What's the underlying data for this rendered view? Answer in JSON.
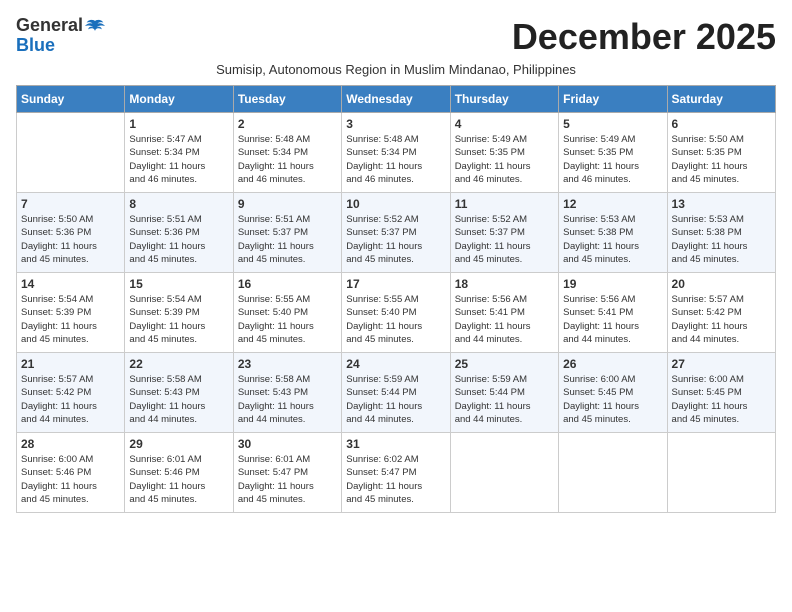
{
  "logo": {
    "general": "General",
    "blue": "Blue"
  },
  "title": "December 2025",
  "subtitle": "Sumisip, Autonomous Region in Muslim Mindanao, Philippines",
  "days_header": [
    "Sunday",
    "Monday",
    "Tuesday",
    "Wednesday",
    "Thursday",
    "Friday",
    "Saturday"
  ],
  "weeks": [
    [
      {
        "day": "",
        "info": ""
      },
      {
        "day": "1",
        "info": "Sunrise: 5:47 AM\nSunset: 5:34 PM\nDaylight: 11 hours\nand 46 minutes."
      },
      {
        "day": "2",
        "info": "Sunrise: 5:48 AM\nSunset: 5:34 PM\nDaylight: 11 hours\nand 46 minutes."
      },
      {
        "day": "3",
        "info": "Sunrise: 5:48 AM\nSunset: 5:34 PM\nDaylight: 11 hours\nand 46 minutes."
      },
      {
        "day": "4",
        "info": "Sunrise: 5:49 AM\nSunset: 5:35 PM\nDaylight: 11 hours\nand 46 minutes."
      },
      {
        "day": "5",
        "info": "Sunrise: 5:49 AM\nSunset: 5:35 PM\nDaylight: 11 hours\nand 46 minutes."
      },
      {
        "day": "6",
        "info": "Sunrise: 5:50 AM\nSunset: 5:35 PM\nDaylight: 11 hours\nand 45 minutes."
      }
    ],
    [
      {
        "day": "7",
        "info": "Sunrise: 5:50 AM\nSunset: 5:36 PM\nDaylight: 11 hours\nand 45 minutes."
      },
      {
        "day": "8",
        "info": "Sunrise: 5:51 AM\nSunset: 5:36 PM\nDaylight: 11 hours\nand 45 minutes."
      },
      {
        "day": "9",
        "info": "Sunrise: 5:51 AM\nSunset: 5:37 PM\nDaylight: 11 hours\nand 45 minutes."
      },
      {
        "day": "10",
        "info": "Sunrise: 5:52 AM\nSunset: 5:37 PM\nDaylight: 11 hours\nand 45 minutes."
      },
      {
        "day": "11",
        "info": "Sunrise: 5:52 AM\nSunset: 5:37 PM\nDaylight: 11 hours\nand 45 minutes."
      },
      {
        "day": "12",
        "info": "Sunrise: 5:53 AM\nSunset: 5:38 PM\nDaylight: 11 hours\nand 45 minutes."
      },
      {
        "day": "13",
        "info": "Sunrise: 5:53 AM\nSunset: 5:38 PM\nDaylight: 11 hours\nand 45 minutes."
      }
    ],
    [
      {
        "day": "14",
        "info": "Sunrise: 5:54 AM\nSunset: 5:39 PM\nDaylight: 11 hours\nand 45 minutes."
      },
      {
        "day": "15",
        "info": "Sunrise: 5:54 AM\nSunset: 5:39 PM\nDaylight: 11 hours\nand 45 minutes."
      },
      {
        "day": "16",
        "info": "Sunrise: 5:55 AM\nSunset: 5:40 PM\nDaylight: 11 hours\nand 45 minutes."
      },
      {
        "day": "17",
        "info": "Sunrise: 5:55 AM\nSunset: 5:40 PM\nDaylight: 11 hours\nand 45 minutes."
      },
      {
        "day": "18",
        "info": "Sunrise: 5:56 AM\nSunset: 5:41 PM\nDaylight: 11 hours\nand 44 minutes."
      },
      {
        "day": "19",
        "info": "Sunrise: 5:56 AM\nSunset: 5:41 PM\nDaylight: 11 hours\nand 44 minutes."
      },
      {
        "day": "20",
        "info": "Sunrise: 5:57 AM\nSunset: 5:42 PM\nDaylight: 11 hours\nand 44 minutes."
      }
    ],
    [
      {
        "day": "21",
        "info": "Sunrise: 5:57 AM\nSunset: 5:42 PM\nDaylight: 11 hours\nand 44 minutes."
      },
      {
        "day": "22",
        "info": "Sunrise: 5:58 AM\nSunset: 5:43 PM\nDaylight: 11 hours\nand 44 minutes."
      },
      {
        "day": "23",
        "info": "Sunrise: 5:58 AM\nSunset: 5:43 PM\nDaylight: 11 hours\nand 44 minutes."
      },
      {
        "day": "24",
        "info": "Sunrise: 5:59 AM\nSunset: 5:44 PM\nDaylight: 11 hours\nand 44 minutes."
      },
      {
        "day": "25",
        "info": "Sunrise: 5:59 AM\nSunset: 5:44 PM\nDaylight: 11 hours\nand 44 minutes."
      },
      {
        "day": "26",
        "info": "Sunrise: 6:00 AM\nSunset: 5:45 PM\nDaylight: 11 hours\nand 45 minutes."
      },
      {
        "day": "27",
        "info": "Sunrise: 6:00 AM\nSunset: 5:45 PM\nDaylight: 11 hours\nand 45 minutes."
      }
    ],
    [
      {
        "day": "28",
        "info": "Sunrise: 6:00 AM\nSunset: 5:46 PM\nDaylight: 11 hours\nand 45 minutes."
      },
      {
        "day": "29",
        "info": "Sunrise: 6:01 AM\nSunset: 5:46 PM\nDaylight: 11 hours\nand 45 minutes."
      },
      {
        "day": "30",
        "info": "Sunrise: 6:01 AM\nSunset: 5:47 PM\nDaylight: 11 hours\nand 45 minutes."
      },
      {
        "day": "31",
        "info": "Sunrise: 6:02 AM\nSunset: 5:47 PM\nDaylight: 11 hours\nand 45 minutes."
      },
      {
        "day": "",
        "info": ""
      },
      {
        "day": "",
        "info": ""
      },
      {
        "day": "",
        "info": ""
      }
    ]
  ]
}
